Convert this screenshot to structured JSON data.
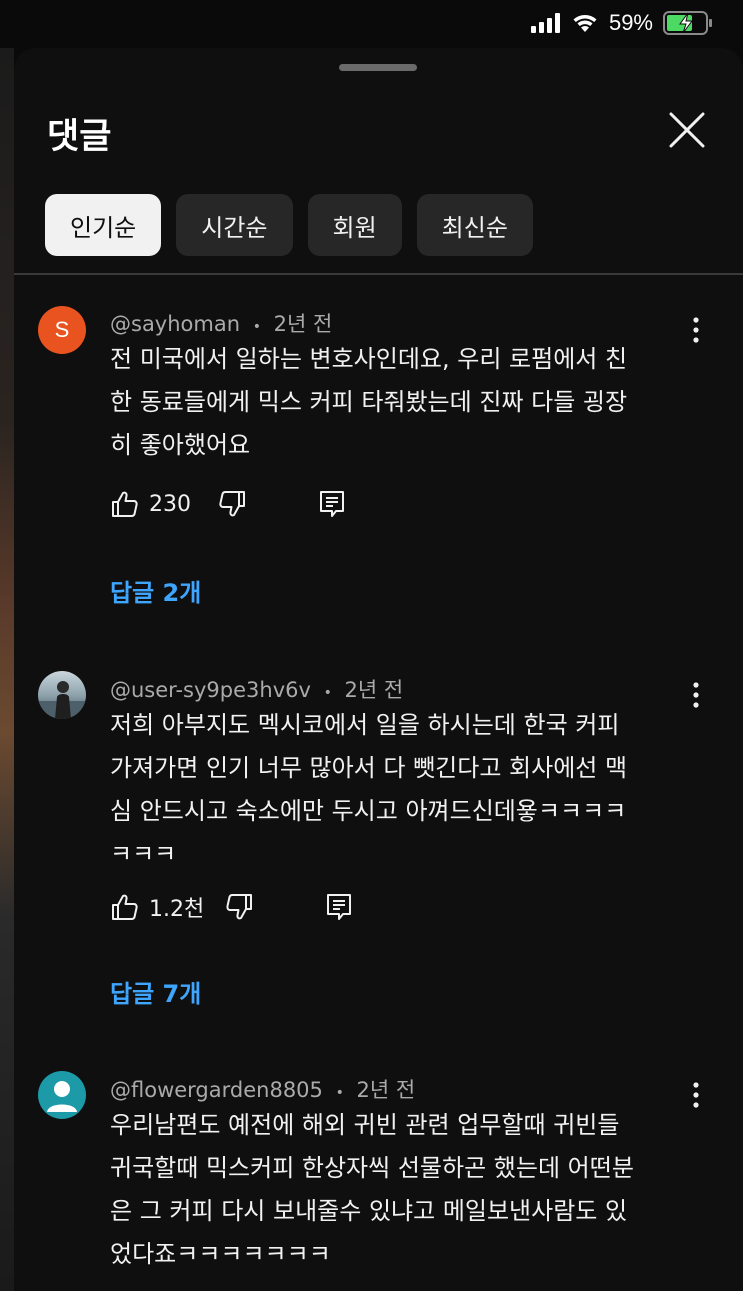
{
  "status": {
    "battery": "59%"
  },
  "header": {
    "title": "댓글"
  },
  "chips": [
    {
      "label": "인기순",
      "active": true
    },
    {
      "label": "시간순"
    },
    {
      "label": "회원"
    },
    {
      "label": "최신순"
    }
  ],
  "comments": [
    {
      "author": "@sayhoman",
      "sep": "•",
      "time": "2년 전",
      "avatar_letter": "S",
      "avatar_color": "#e8531f",
      "lines": [
        "전 미국에서 일하는 변호사인데요, 우리 로펌에서 친",
        "한 동료들에게 믹스 커피 타줘봤는데 진짜 다들 굉장",
        "히 좋아했어요"
      ],
      "likes": "230",
      "replies": "답글 2개"
    },
    {
      "author": "@user-sy9pe3hv6v",
      "sep": "•",
      "time": "2년 전",
      "lines": [
        "저희 아부지도 멕시코에서 일을 하시는데 한국 커피",
        "가져가면 인기 너무 많아서 다 뺏긴다고 회사에선 맥",
        "심 안드시고 숙소에만 두시고 아껴드신데욯ㅋㅋㅋㅋ",
        "ㅋㅋㅋ"
      ],
      "likes": "1.2천",
      "replies": "답글 7개"
    },
    {
      "author": "@flowergarden8805",
      "sep": "•",
      "time": "2년 전",
      "avatar_color": "#1c9aa8",
      "lines": [
        "우리남편도 예전에 해외 귀빈 관련 업무할때 귀빈들",
        "귀국할때 믹스커피 한상자씩 선물하곤 했는데 어떤분",
        "은 그 커피 다시 보내줄수 있냐고 메일보낸사람도 있",
        "었다죠ㅋㅋㅋㅋㅋㅋㅋ"
      ]
    }
  ]
}
